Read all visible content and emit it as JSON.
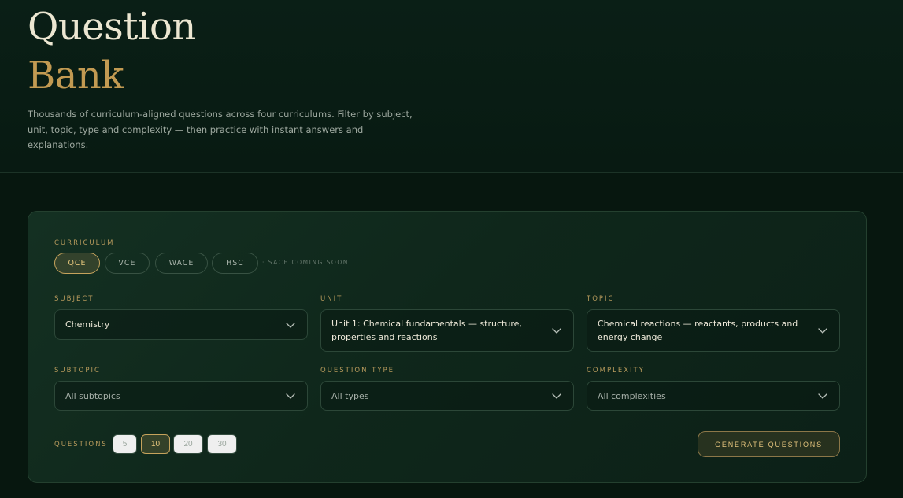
{
  "hero": {
    "title_line1": "Question",
    "title_line2": "Bank",
    "description": "Thousands of curriculum-aligned questions across four curriculums. Filter by subject, unit, topic, type and complexity — then practice with instant answers and explanations."
  },
  "curriculum": {
    "label": "CURRICULUM",
    "options": [
      {
        "label": "QCE",
        "active": true
      },
      {
        "label": "VCE",
        "active": false
      },
      {
        "label": "WACE",
        "active": false
      },
      {
        "label": "HSC",
        "active": false
      }
    ],
    "note": "· SACE COMING SOON"
  },
  "filters": {
    "subject": {
      "label": "SUBJECT",
      "value": "Chemistry"
    },
    "unit": {
      "label": "UNIT",
      "value": "Unit 1: Chemical fundamentals — structure, properties and reactions"
    },
    "topic": {
      "label": "TOPIC",
      "value": "Chemical reactions — reactants, products and energy change"
    },
    "subtopic": {
      "label": "SUBTOPIC",
      "value": "All subtopics"
    },
    "question_type": {
      "label": "QUESTION TYPE",
      "value": "All types"
    },
    "complexity": {
      "label": "COMPLEXITY",
      "value": "All complexities"
    }
  },
  "questions": {
    "label": "QUESTIONS",
    "options": [
      {
        "label": "5",
        "active": false
      },
      {
        "label": "10",
        "active": true
      },
      {
        "label": "20",
        "active": false
      },
      {
        "label": "30",
        "active": false
      }
    ]
  },
  "generate_label": "GENERATE QUESTIONS",
  "icons": {
    "dropdown": "chevron-down-icon"
  },
  "colors": {
    "background": "#07170f",
    "accent_gold": "#c29a52",
    "card": "#132d20"
  }
}
